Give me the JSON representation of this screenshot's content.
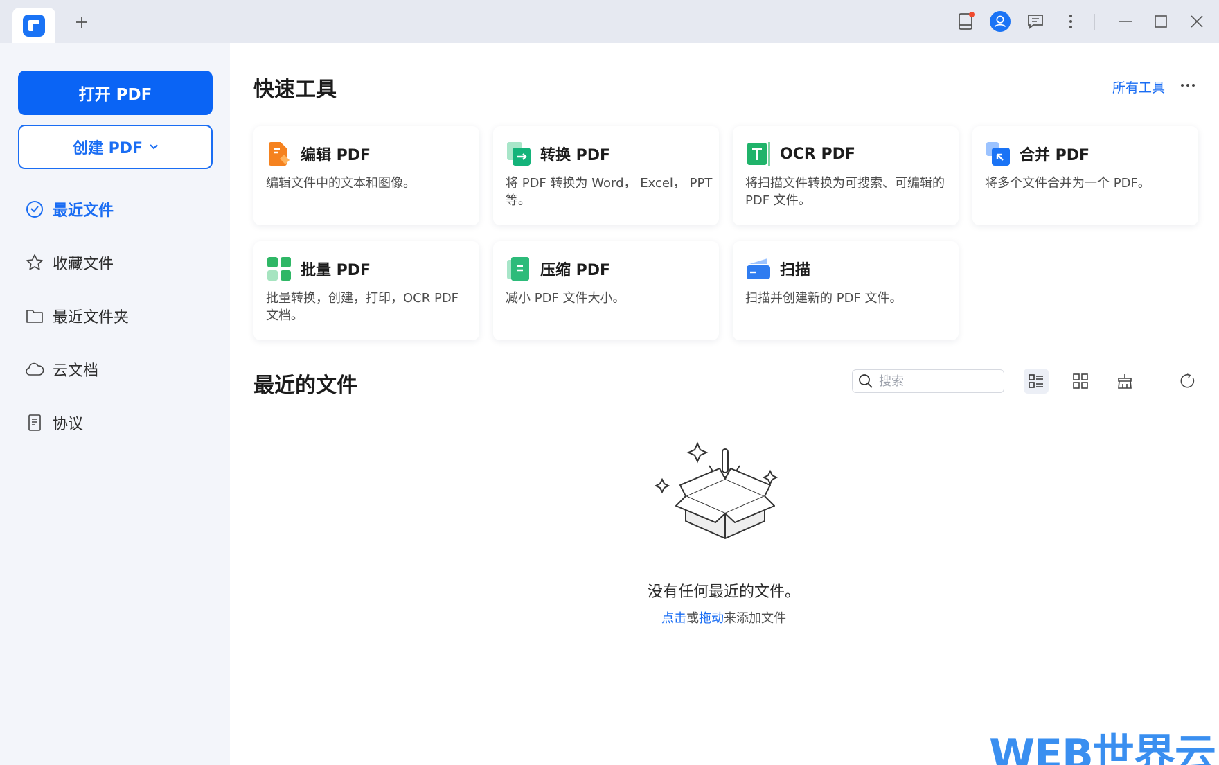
{
  "titlebar": {
    "new_tab_label": "+",
    "icons": [
      "notification-icon",
      "account-icon",
      "feedback-icon",
      "more-vertical-icon",
      "minimize-icon",
      "maximize-icon",
      "close-icon"
    ]
  },
  "sidebar": {
    "open_pdf": "打开 PDF",
    "create_pdf": "创建 PDF",
    "items": [
      {
        "label": "最近文件",
        "icon": "clock-icon",
        "active": true
      },
      {
        "label": "收藏文件",
        "icon": "star-icon",
        "active": false
      },
      {
        "label": "最近文件夹",
        "icon": "folder-icon",
        "active": false
      },
      {
        "label": "云文档",
        "icon": "cloud-icon",
        "active": false
      },
      {
        "label": "协议",
        "icon": "document-icon",
        "active": false
      }
    ]
  },
  "quick_tools": {
    "title": "快速工具",
    "all_tools": "所有工具",
    "tools": [
      {
        "name": "编辑 PDF",
        "desc": "编辑文件中的文本和图像。",
        "icon": "edit-pdf-icon",
        "color": "#f5821f"
      },
      {
        "name": "转换 PDF",
        "desc": "将 PDF 转换为 Word， Excel， PPT等。",
        "icon": "convert-pdf-icon",
        "color": "#1bb877"
      },
      {
        "name": "OCR PDF",
        "desc": "将扫描文件转换为可搜索、可编辑的 PDF 文件。",
        "icon": "ocr-pdf-icon",
        "color": "#20b36a"
      },
      {
        "name": "合并 PDF",
        "desc": "将多个文件合并为一个 PDF。",
        "icon": "merge-pdf-icon",
        "color": "#1a73f5"
      },
      {
        "name": "批量 PDF",
        "desc": "批量转换，创建，打印，OCR PDF 文档。",
        "icon": "batch-pdf-icon",
        "color": "#2fb766"
      },
      {
        "name": "压缩 PDF",
        "desc": "减小 PDF 文件大小。",
        "icon": "compress-pdf-icon",
        "color": "#2dbb7a"
      },
      {
        "name": "扫描",
        "desc": "扫描并创建新的 PDF 文件。",
        "icon": "scan-icon",
        "color": "#2f7cf0"
      }
    ]
  },
  "recent": {
    "title": "最近的文件",
    "search_placeholder": "搜索",
    "empty_text": "没有任何最近的文件。",
    "hint_click": "点击",
    "hint_or": "或",
    "hint_drag": "拖动",
    "hint_rest": "来添加文件"
  },
  "watermark": "WEB世界云",
  "colors": {
    "accent": "#1a6df3",
    "sidebar_bg": "#f3f5fa",
    "titlebar_bg": "#e6e9f1"
  }
}
